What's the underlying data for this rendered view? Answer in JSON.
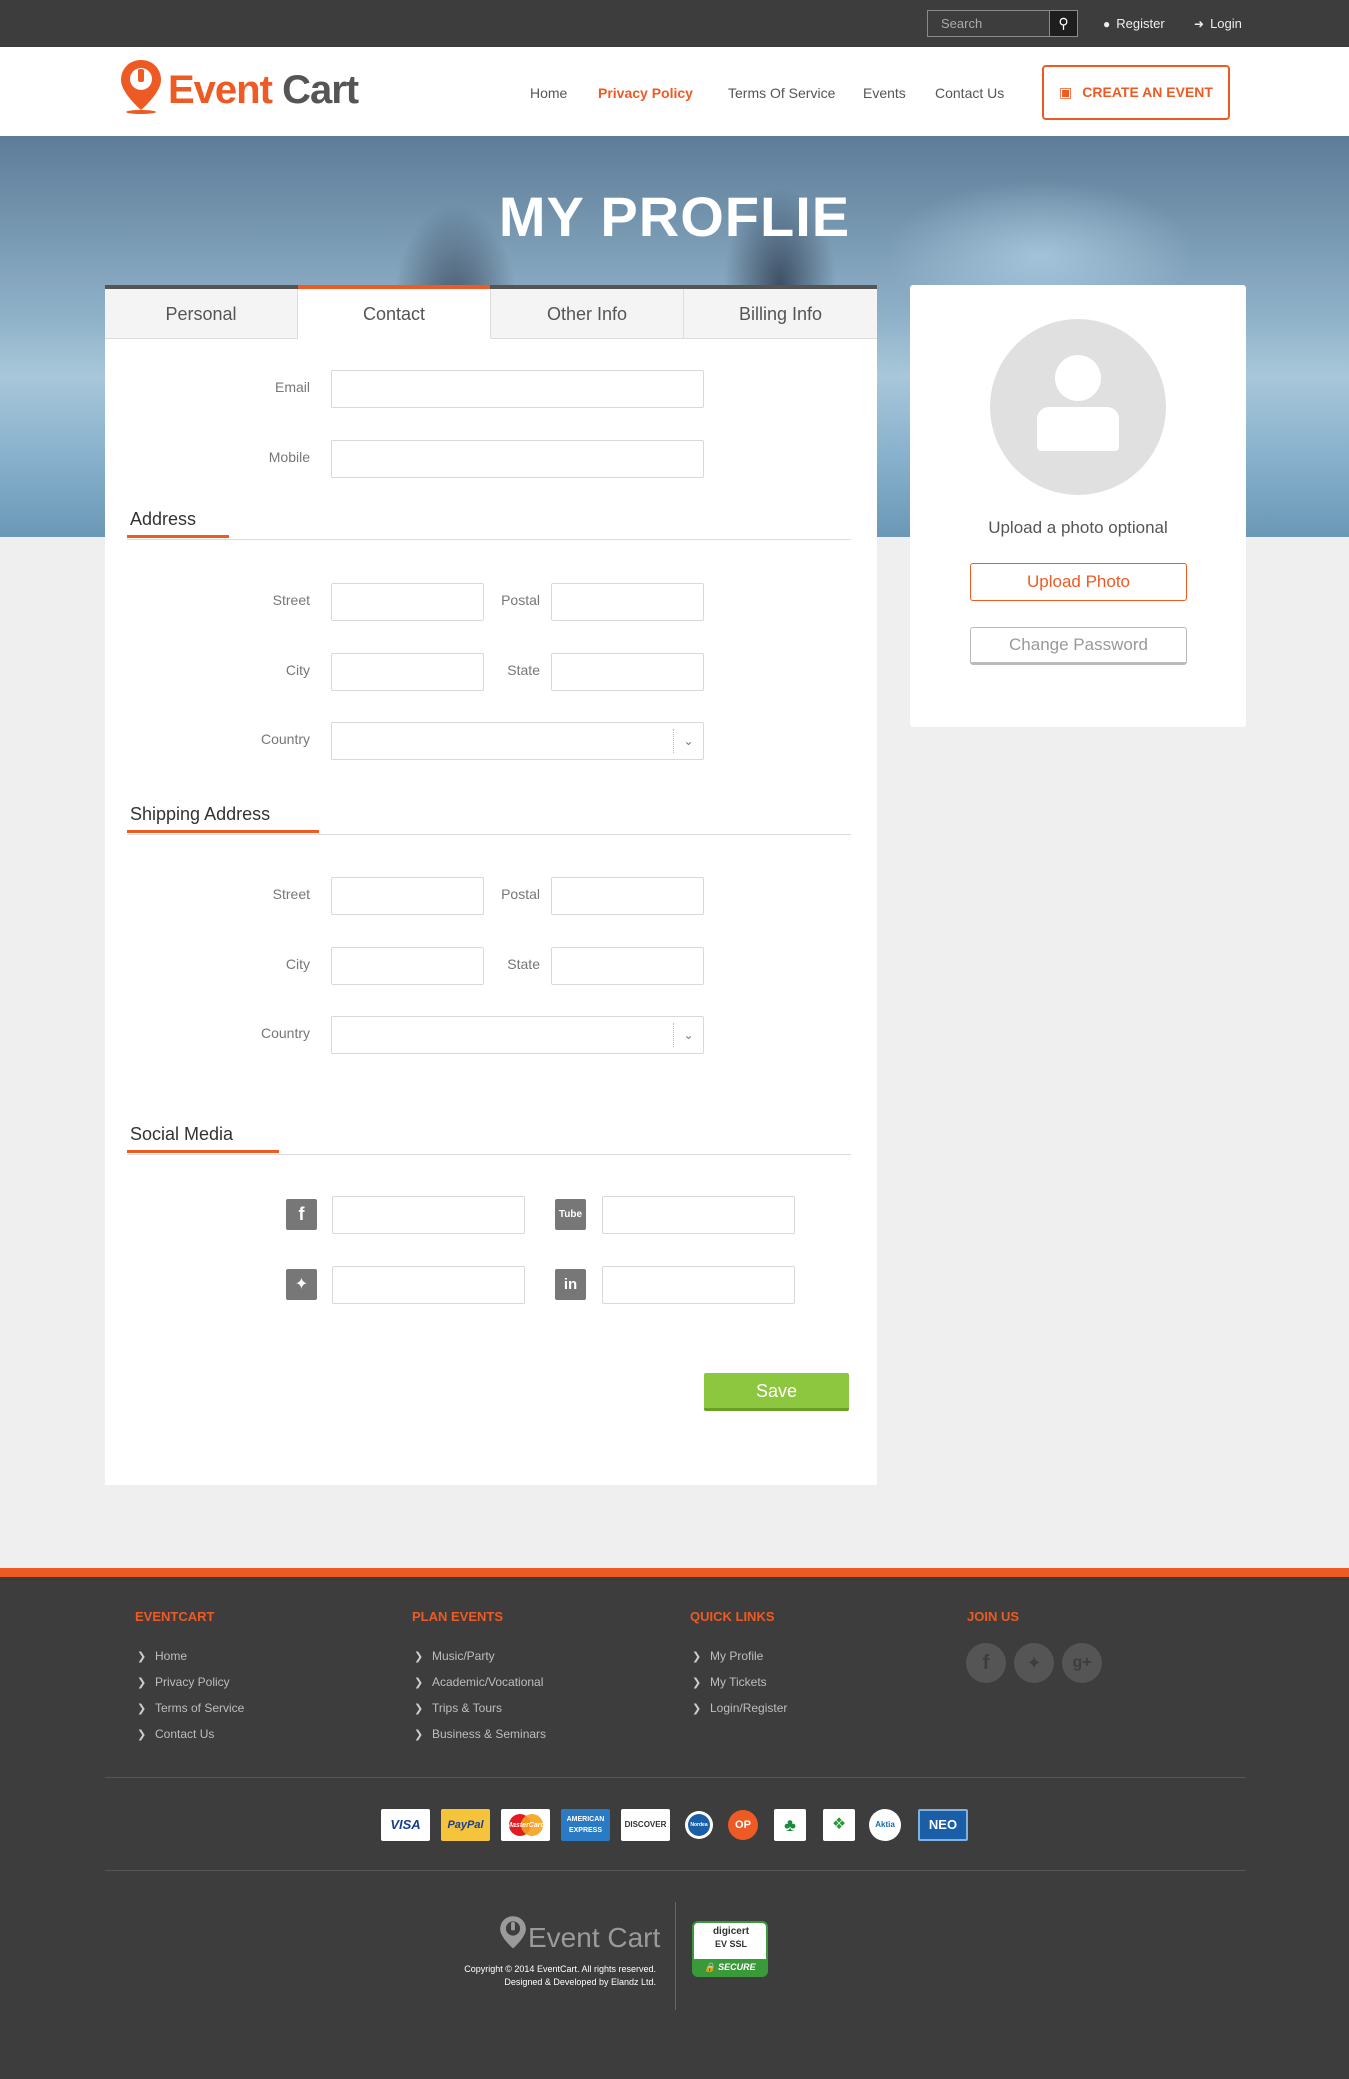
{
  "topbar": {
    "search_placeholder": "Search",
    "register_label": "Register",
    "login_label": "Login"
  },
  "brand": {
    "part1": "Event",
    "part2": "Cart"
  },
  "nav": {
    "items": [
      {
        "label": "Home"
      },
      {
        "label": "Privacy Policy",
        "active": true
      },
      {
        "label": "Terms Of Service"
      },
      {
        "label": "Events"
      },
      {
        "label": "Contact Us"
      }
    ],
    "create_button": "CREATE AN EVENT"
  },
  "hero": {
    "title": "MY PROFLIE"
  },
  "tabs": [
    {
      "label": "Personal"
    },
    {
      "label": "Contact",
      "active": true
    },
    {
      "label": "Other Info"
    },
    {
      "label": "Billing Info"
    }
  ],
  "contact": {
    "email_label": "Email",
    "mobile_label": "Mobile"
  },
  "address": {
    "title": "Address",
    "street_label": "Street",
    "postal_label": "Postal",
    "city_label": "City",
    "state_label": "State",
    "country_label": "Country"
  },
  "shipping": {
    "title": "Shipping Address",
    "street_label": "Street",
    "postal_label": "Postal",
    "city_label": "City",
    "state_label": "State",
    "country_label": "Country"
  },
  "social": {
    "title": "Social Media",
    "icons": [
      "facebook-icon",
      "youtube-icon",
      "twitter-icon",
      "linkedin-icon"
    ]
  },
  "save_label": "Save",
  "profile_side": {
    "upload_text": "Upload a photo optional",
    "upload_button": "Upload Photo",
    "change_password_button": "Change Password"
  },
  "footer": {
    "col1": {
      "title": "EVENTCART",
      "links": [
        "Home",
        "Privacy Policy",
        "Terms of Service",
        "Contact Us"
      ]
    },
    "col2": {
      "title": "PLAN EVENTS",
      "links": [
        "Music/Party",
        "Academic/Vocational",
        "Trips & Tours",
        "Business & Seminars"
      ]
    },
    "col3": {
      "title": "QUICK LINKS",
      "links": [
        "My Profile",
        "My Tickets",
        "Login/Register"
      ]
    },
    "col4": {
      "title": "JOIN US"
    },
    "payments": [
      "VISA",
      "PayPal",
      "MasterCard",
      "AMERICAN EXPRESS",
      "DISCOVER",
      "Nordea",
      "OP",
      "S-Pankki",
      "Handelsbanken",
      "Aktia",
      "NEO"
    ],
    "copyright": "Copyright © 2014 EventCart. All rights reserved.",
    "designed": "Designed & Developed by Elandz Ltd.",
    "badge": {
      "line1": "digicert",
      "line2": "EV SSL",
      "line3": "SECURE"
    }
  },
  "colors": {
    "accent": "#ee5a24",
    "save": "#8dc63f",
    "dark": "#3d3d3d"
  }
}
